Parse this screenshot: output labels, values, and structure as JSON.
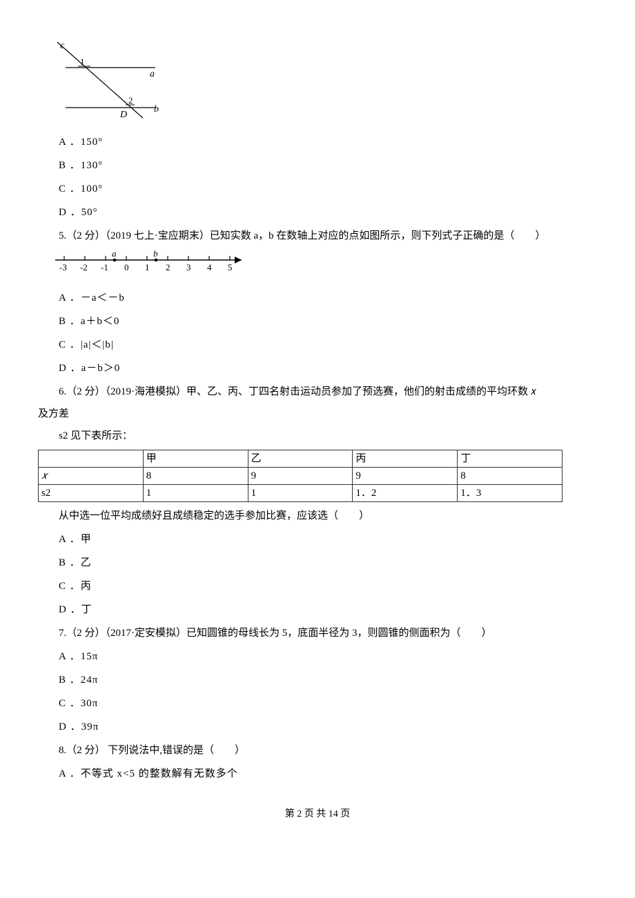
{
  "q4": {
    "optA": "A ．150°",
    "optB": "B ．130°",
    "optC": "C ．100°",
    "optD": "D ．50°"
  },
  "q5": {
    "stem": "5.（2 分）（2019 七上·宝应期末）已知实数 a，b 在数轴上对应的点如图所示，则下列式子正确的是（　　）",
    "optA": "A ．－a＜－b",
    "optB": "B ．a＋b＜0",
    "optC_prefix": "C ．",
    "optC_expr": "|a|＜|b|",
    "optD": "D ．a－b＞0"
  },
  "q6": {
    "stem_line1": "6.（2 分）（2019·海港模拟）甲、乙、丙、丁四名射击运动员参加了预选赛，他们的射击成绩的平均环数 𝑥",
    "stem_line2": "及方差",
    "stem_line3": "s2 见下表所示：",
    "table": {
      "header": [
        "",
        "甲",
        "乙",
        "丙",
        "丁"
      ],
      "row_x": [
        "𝑥",
        "8",
        "9",
        "9",
        "8"
      ],
      "row_s2": [
        "s2",
        "1",
        "1",
        "1．2",
        "1．3"
      ]
    },
    "followup": "从中选一位平均成绩好且成绩稳定的选手参加比赛，应该选（　　）",
    "optA": "A ．甲",
    "optB": "B ．乙",
    "optC": "C ．丙",
    "optD": "D ．丁"
  },
  "q7": {
    "stem": "7.（2 分）（2017·定安模拟）已知圆锥的母线长为 5，底面半径为 3，则圆锥的侧面积为（　　）",
    "optA": "A ．15π",
    "optB": "B ．24π",
    "optC": "C ．30π",
    "optD": "D ．39π"
  },
  "q8": {
    "stem": "8.（2 分） 下列说法中,错误的是（　　）",
    "optA": "A ．不等式 x<5 的整数解有无数多个"
  },
  "footer": "第 2 页 共 14 页"
}
